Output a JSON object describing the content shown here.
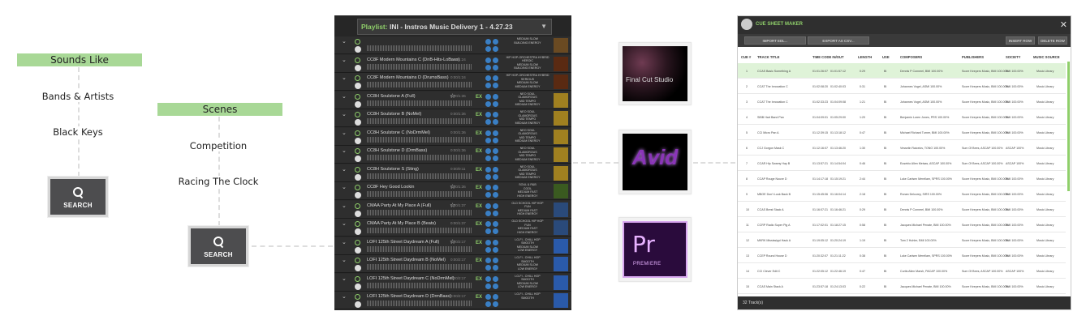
{
  "flow_left": {
    "sounds_like": "Sounds Like",
    "items": [
      "Bands & Artists",
      "Black Keys"
    ],
    "search": "SEARCH"
  },
  "flow_mid": {
    "scenes": "Scenes",
    "items": [
      "Competition",
      "Racing The Clock"
    ],
    "search": "SEARCH"
  },
  "playlist": {
    "label": "Playlist:",
    "name": "INI - Instros Music Delivery 1 - 4.27.23",
    "rows": [
      {
        "title": "",
        "dur": "",
        "tags": [
          "MEDIUM SLOW",
          "BUILDING ENERGY"
        ],
        "ex": false,
        "star": false,
        "art": "#6a4a22"
      },
      {
        "title": "CC8F Modern Mountains C (DnB-Hits-LoBass)",
        "dur": "0:00/1:24",
        "tags": [
          "HIP HOP-ORCHESTRA HYBRID",
          "HEROIC",
          "MEDIUM SLOW",
          "BUILDING ENERGY"
        ],
        "ex": false,
        "star": false,
        "art": "#5a2a12"
      },
      {
        "title": "CC8F Modern Mountains D (DrumsBass)",
        "dur": "0:00/1:24",
        "tags": [
          "HIP HOP-ORCHESTRA HYBRID",
          "SERIOUS",
          "MEDIUM SLOW",
          "MEDIUM ENERGY"
        ],
        "ex": false,
        "star": false,
        "art": "#5a2a12"
      },
      {
        "title": "CC8H Soulstone A (Full)",
        "dur": "0:00/1:36",
        "tags": [
          "NEO SOUL",
          "GLAMOROUS",
          "MID TEMPO",
          "MEDIUM ENERGY"
        ],
        "ex": true,
        "star": true,
        "art": "#a08020"
      },
      {
        "title": "CC8H Soulstone B (NoMel)",
        "dur": "0:00/1:36",
        "tags": [
          "NEO SOUL",
          "GLAMOROUS",
          "MID TEMPO",
          "MEDIUM ENERGY"
        ],
        "ex": true,
        "star": false,
        "art": "#a08020"
      },
      {
        "title": "CC8H Soulstone C (NoDrmMel)",
        "dur": "0:00/1:36",
        "tags": [
          "NEO SOUL",
          "GLAMOROUS",
          "MID TEMPO",
          "MEDIUM ENERGY"
        ],
        "ex": true,
        "star": false,
        "art": "#a08020"
      },
      {
        "title": "CC8H Soulstone D (DrmBass)",
        "dur": "0:00/1:36",
        "tags": [
          "NEO SOUL",
          "GLAMOROUS",
          "MID TEMPO",
          "MEDIUM ENERGY"
        ],
        "ex": true,
        "star": false,
        "art": "#a08020"
      },
      {
        "title": "CC8H Soulstone S (Sting)",
        "dur": "0:00/0:11",
        "tags": [
          "NEO SOUL",
          "GLAMOROUS",
          "MID TEMPO",
          "MEDIUM ENERGY"
        ],
        "ex": true,
        "star": false,
        "art": "#a08020"
      },
      {
        "title": "CC8F Hey Good Lookin",
        "dur": "0:00/1:36",
        "tags": [
          "SOUL & R&B",
          "COOL",
          "MEDIUM FAST",
          "HIGH ENERGY"
        ],
        "ex": true,
        "star": true,
        "art": "#3a5a20"
      },
      {
        "title": "CMAA Party At My Place A (Full)",
        "dur": "0:00/1:37",
        "tags": [
          "OLD SCHOOL HIP HOP",
          "FUN",
          "MEDIUM FAST",
          "HIGH ENERGY"
        ],
        "ex": true,
        "star": true,
        "art": "#2a4a7a"
      },
      {
        "title": "CMAA Party At My Place B (Beats)",
        "dur": "0:00/1:37",
        "tags": [
          "OLD SCHOOL HIP HOP",
          "FUN",
          "MEDIUM FAST",
          "HIGH ENERGY"
        ],
        "ex": true,
        "star": false,
        "art": "#2a4a7a"
      },
      {
        "title": "LOFI 125th Street Daydream A (Full)",
        "dur": "0:00/2:17",
        "tags": [
          "LO-FI - CHILL HOP",
          "SMOOTH",
          "MEDIUM SLOW",
          "LOW ENERGY"
        ],
        "ex": true,
        "star": true,
        "art": "#2a5aaa"
      },
      {
        "title": "LOFI 125th Street Daydream B (NoMel)",
        "dur": "0:00/2:17",
        "tags": [
          "LO-FI - CHILL HOP",
          "SMOOTH",
          "MEDIUM SLOW",
          "LOW ENERGY"
        ],
        "ex": true,
        "star": false,
        "art": "#2a5aaa"
      },
      {
        "title": "LOFI 125th Street Daydream C (NoDrmMel)",
        "dur": "0:00/2:17",
        "tags": [
          "LO-FI - CHILL HOP",
          "SMOOTH",
          "MEDIUM SLOW",
          "LOW ENERGY"
        ],
        "ex": true,
        "star": false,
        "art": "#2a5aaa"
      },
      {
        "title": "LOFI 125th Street Daydream D (DrmBass)",
        "dur": "0:00/2:17",
        "tags": [
          "LO-FI - CHILL HOP",
          "SMOOTH"
        ],
        "ex": true,
        "star": false,
        "art": "#2a5aaa"
      }
    ]
  },
  "apps": {
    "fcs": "Final Cut Studio",
    "avid": "Avid",
    "premiere_mark": "Pr",
    "premiere_name": "PREMIERE"
  },
  "cue_sheet": {
    "title": "CUE SHEET MAKER",
    "close": "✕",
    "buttons": {
      "import": "IMPORT EDL...",
      "export": "EXPORT AS CSV...",
      "insert": "INSERT ROW",
      "delete": "DELETE ROW"
    },
    "columns": [
      "CUE #",
      "TRACK TITLE",
      "TIME CODE IN/OUT",
      "LENGTH",
      "USE",
      "COMPOSERS",
      "PUBLISHERS",
      "SOCIETY",
      "MUSIC SOURCE"
    ],
    "rows": [
      [
        "1",
        "CCAS Basic Something A",
        "01:01:26:07",
        "01:01:57:12",
        "0:29",
        "BI",
        "Dennis P Conneel, BMI 100.00%",
        "Score Keepers Music, BMI 100.00%",
        "BMI 100.00%",
        "Music Library"
      ],
      [
        "2",
        "CCAT The Innovation C",
        "01:02:08:20",
        "01:02:40:03",
        "0:31",
        "BI",
        "Johannes Vogel, ASMI 100.00%",
        "Score Keepers Music, BMI 100.00%",
        "BMI 100.00%",
        "Music Library"
      ],
      [
        "3",
        "CCAT The Innovation C",
        "01:02:33:23",
        "01:04:09:08",
        "1:21",
        "BI",
        "Johannes Vogel, ASMI 100.00%",
        "Score Keepers Music, BMI 100.00%",
        "BMI 100.00%",
        "Music Library"
      ],
      [
        "4",
        "SIBB Hart Band Pan",
        "01:04:09:01",
        "01:05:29:00",
        "1:20",
        "BI",
        "Benjamin Loren Jones, PRS 100.00%",
        "Score Keepers Music, BMI 100.00%",
        "BMI 100.00%",
        "Music Library"
      ],
      [
        "5",
        "CCI Micro Pan A",
        "01:12:39:15",
        "01:13:18:12",
        "0:47",
        "BI",
        "Michael Richard Turner, BMI 100.00%",
        "Score Keepers Music, BMI 100.00%",
        "BMI 100.00%",
        "Music Library"
      ],
      [
        "6",
        "CCJ Gorgon Mask C",
        "01:12:16:07",
        "01:13:46:20",
        "1:30",
        "BI",
        "Vesselin Raicelov, TONO 100.00%",
        "Sum Of Bees, ASCAP 100.00%",
        "ASCAP 100%",
        "Music Library"
      ],
      [
        "7",
        "CCAR Hip Swamy Hay B",
        "01:13:57:21",
        "01:14:54:04",
        "0:46",
        "BI",
        "Eusebio Allen Meisas, ASCAP 100.00%",
        "Sum Of Bees, ASCAP 100.00%",
        "ASCAP 100%",
        "Music Library"
      ],
      [
        "8",
        "CCAP Rouge Nouve D",
        "01:14:17:18",
        "01:15:19:21",
        "2:44",
        "BI",
        "Luke Carlsen Merellam, SPRS 100.00%",
        "Score Keepers Music, BMI 100.00%",
        "BMI 100.00%",
        "Music Library"
      ],
      [
        "9",
        "MBOE Don't Look Back B",
        "01:15:45:06",
        "01:16:04:14",
        "2:18",
        "BI",
        "Ronan Delcorey, SIRS 100.00%",
        "Score Keepers Music, BMI 100.00%",
        "BMI 100.00%",
        "Music Library"
      ],
      [
        "10",
        "CCAS Brest Stack A",
        "01:16:07:21",
        "01:16:46:21",
        "0:29",
        "BI",
        "Dennis P Conneel, BMI 100.00%",
        "Score Keepers Music, BMI 100.00%",
        "BMI 100.00%",
        "Music Library"
      ],
      [
        "11",
        "CCRP Radio Super Pig A",
        "01:17:02:01",
        "01:18:27:15",
        "0:58",
        "BI",
        "Jacques Michael Penate, BMI 100.00%",
        "Score Keepers Music, BMI 100.00%",
        "BMI 100.00%",
        "Music Library"
      ],
      [
        "12",
        "MKRK Mississippi Hack A",
        "01:19:05:12",
        "01:20:24:19",
        "1:19",
        "BI",
        "Tom 2 Huhler, BMI 100.00%",
        "Score Keepers Music, BMI 100.00%",
        "BMI 100.00%",
        "Music Library"
      ],
      [
        "13",
        "CCEP Round House D",
        "01:20:32:07",
        "01:21:11:22",
        "0:38",
        "BI",
        "Luke Carlsen Merellam, SPRS 100.00%",
        "Score Keepers Music, BMI 100.00%",
        "BMI 100.00%",
        "Music Library"
      ],
      [
        "14",
        "CCI Clever Edit C",
        "01:22:05:12",
        "01:22:46:19",
        "0:47",
        "BI",
        "Curtis Allen Marsh, PACAP 100.00%",
        "Sum Of Bees, ASCAP 100.00%",
        "ASCAP 100%",
        "Music Library"
      ],
      [
        "15",
        "CCAS Main Stack A",
        "01:23:57:18",
        "01:24:13:03",
        "0:22",
        "BI",
        "Jacques Michael Penate, BMI 100.00%",
        "Score Keepers Music, BMI 100.00%",
        "BMI 100.00%",
        "Music Library"
      ]
    ],
    "footer": "32 Track(s)"
  },
  "colors": {
    "accent": "#8fcf6a",
    "pill": "#a8d896",
    "highlight_row": "#dff3d8"
  }
}
